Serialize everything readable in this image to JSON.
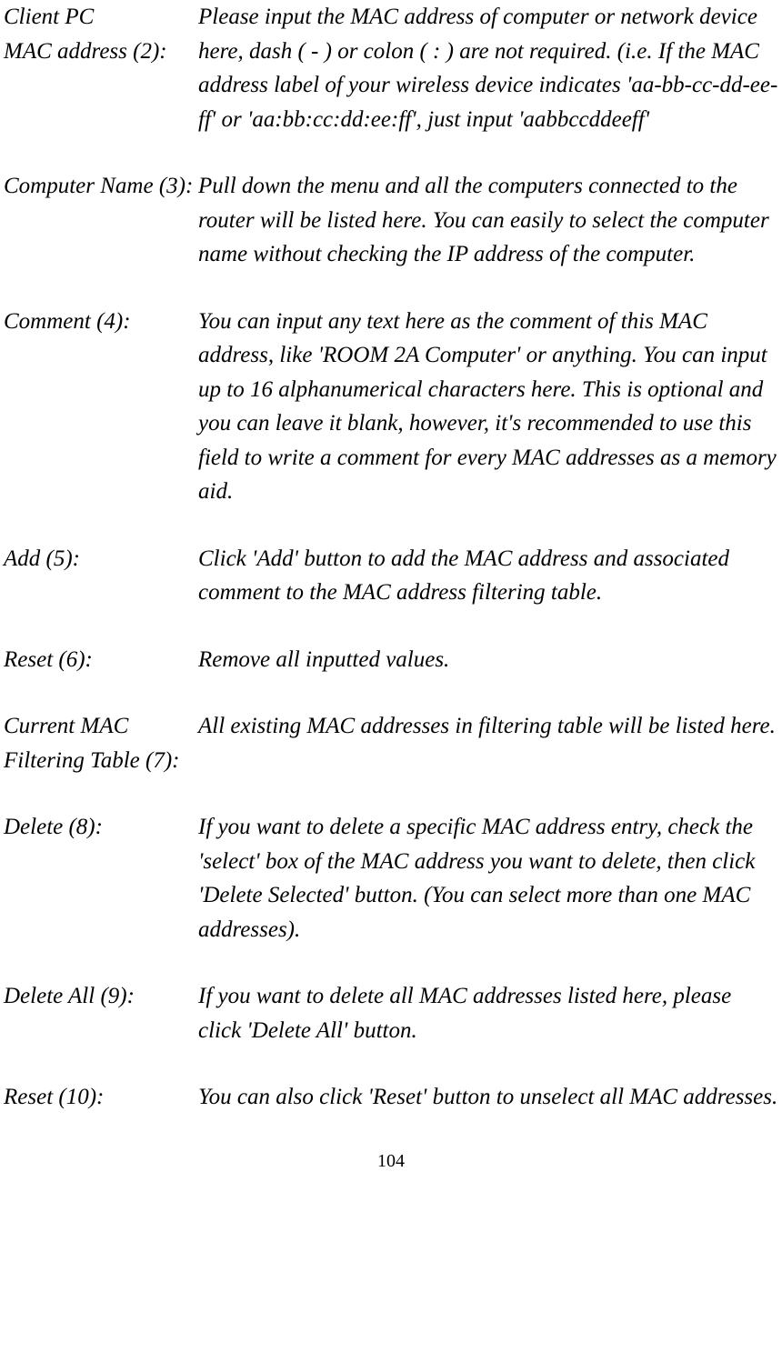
{
  "items": [
    {
      "term": "Client PC\nMAC address (2):",
      "desc": "Please input the MAC address of computer or network device here, dash ( - ) or colon ( : ) are not required. (i.e. If the MAC address label of your wireless device indicates 'aa-bb-cc-dd-ee-ff' or 'aa:bb:cc:dd:ee:ff', just input 'aabbccddeeff'"
    },
    {
      "term": "Computer Name (3):",
      "desc": "Pull down the menu and all the computers connected to the router will be listed here. You can easily to select the computer name without checking the IP address of the computer."
    },
    {
      "term": "Comment (4):",
      "desc": "You can input any text here as the comment of this MAC address, like 'ROOM 2A Computer' or anything. You can input up to 16 alphanumerical characters here. This is optional and you can leave it blank, however, it's recommended to use this field to write a comment for every MAC addresses as a memory aid."
    },
    {
      "term": "Add (5):",
      "desc": "Click 'Add' button to add the MAC address and associated comment to the MAC address filtering table."
    },
    {
      "term": "Reset (6):",
      "desc": "Remove all inputted values."
    },
    {
      "term": "Current MAC\nFiltering Table (7):",
      "desc": "All existing MAC addresses in filtering table will be listed here."
    },
    {
      "term": "Delete (8):",
      "desc": "If you want to delete a specific MAC address entry, check the 'select' box of the MAC address you want to delete, then click 'Delete Selected' button. (You can select more than one MAC addresses)."
    },
    {
      "term": "Delete All (9):",
      "desc": "If you want to delete all MAC addresses listed here, please click 'Delete All' button."
    },
    {
      "term": "Reset (10):",
      "desc": "You can also click 'Reset' button to unselect all MAC addresses."
    }
  ],
  "pageNumber": "104"
}
